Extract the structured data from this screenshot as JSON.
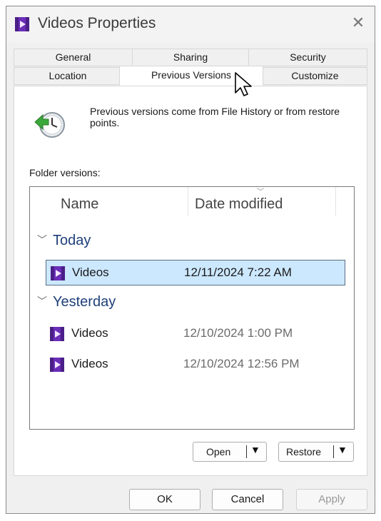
{
  "window": {
    "title": "Videos Properties",
    "close_glyph": "✕"
  },
  "tabs": {
    "row1": [
      "General",
      "Sharing",
      "Security"
    ],
    "row2": [
      "Location",
      "Previous Versions",
      "Customize"
    ],
    "active": "Previous Versions"
  },
  "info": {
    "text": "Previous versions come from File History or from restore points."
  },
  "folder_versions": {
    "label": "Folder versions:",
    "columns": [
      "Name",
      "Date modified"
    ],
    "groups": [
      {
        "name": "Today",
        "items": [
          {
            "name": "Videos",
            "date": "12/11/2024 7:22 AM",
            "selected": true
          }
        ]
      },
      {
        "name": "Yesterday",
        "items": [
          {
            "name": "Videos",
            "date": "12/10/2024 1:00 PM",
            "selected": false
          },
          {
            "name": "Videos",
            "date": "12/10/2024 12:56 PM",
            "selected": false
          }
        ]
      }
    ]
  },
  "actions": {
    "open": "Open",
    "restore": "Restore"
  },
  "footer": {
    "ok": "OK",
    "cancel": "Cancel",
    "apply": "Apply"
  },
  "colors": {
    "group_header": "#1f3f7a",
    "selection": "#cce8ff",
    "folder_icon": "#7b2fbe"
  },
  "icons": [
    "video-folder-icon",
    "restore-clock-icon",
    "close-icon",
    "chevron-down-icon",
    "dropdown-arrow-icon",
    "mouse-cursor-icon"
  ]
}
